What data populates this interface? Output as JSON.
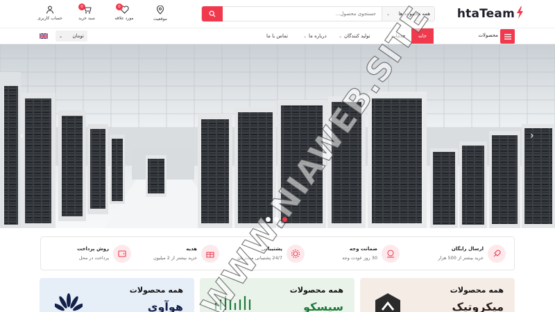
{
  "header": {
    "logo": "htaTeam",
    "search": {
      "category": "همه مجموعه ها",
      "placeholder": "جستجوی محصول..."
    },
    "icons": {
      "location": "موقعیت",
      "wishlist": "مورد علاقه",
      "wishlist_count": "0",
      "cart": "سبد خرید",
      "cart_count": "0",
      "account": "حساب کاربری"
    }
  },
  "nav": {
    "products": "محصولات",
    "items": [
      "خانه",
      "خدمات",
      "تولید کنندگان",
      "درباره ما",
      "تماس با ما"
    ],
    "currency": "تومان"
  },
  "hero": {
    "slide_count": 3,
    "active_slide": 3
  },
  "features": [
    {
      "title": "ارسال رایگان",
      "subtitle": "خرید بیشتر از 500 هزار",
      "icon": "rocket-icon"
    },
    {
      "title": "ضمانت وجه",
      "subtitle": "30 روز عودت وجه",
      "icon": "money-back-icon"
    },
    {
      "title": "پشتیبانی",
      "subtitle": "24/7 پشتیبانی مشتریان",
      "icon": "support-gear-icon"
    },
    {
      "title": "هدیه",
      "subtitle": "خرید بیشتر از 2 میلیون",
      "icon": "gift-icon"
    },
    {
      "title": "روش پرداخت",
      "subtitle": "پرداخت در محل",
      "icon": "wallet-icon"
    }
  ],
  "cards": [
    {
      "title": "همه محصولات",
      "brand": "میکروتیک",
      "bg": "#f6ece6"
    },
    {
      "title": "همه محصولات",
      "brand": "سیسکو",
      "bg": "#eaf3ea"
    },
    {
      "title": "همه محصولات",
      "brand": "هوآوی",
      "bg": "#e6eef8"
    }
  ],
  "watermark": "WWW.NIAWEB.SITE",
  "colors": {
    "accent": "#f0394d"
  }
}
